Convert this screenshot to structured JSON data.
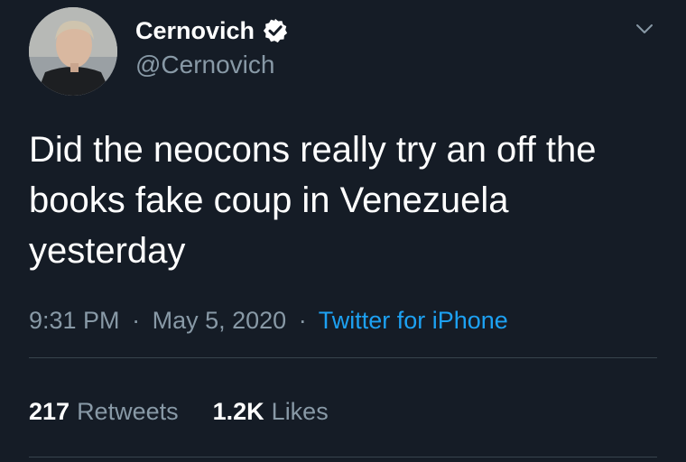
{
  "author": {
    "display_name": "Cernovich",
    "handle": "@Cernovich",
    "verified": true
  },
  "tweet": {
    "text": "Did the neocons really try an off the books fake coup in Venezuela yesterday",
    "time": "9:31 PM",
    "date": "May 5, 2020",
    "separator": "·",
    "source": "Twitter for iPhone"
  },
  "stats": {
    "retweets_count": "217",
    "retweets_label": "Retweets",
    "likes_count": "1.2K",
    "likes_label": "Likes"
  },
  "colors": {
    "background": "#151c26",
    "muted_text": "#8899a6",
    "link": "#1da1f2",
    "divider": "#38444d"
  },
  "icons": {
    "verified": "verified-badge-icon",
    "menu": "chevron-down-icon"
  }
}
